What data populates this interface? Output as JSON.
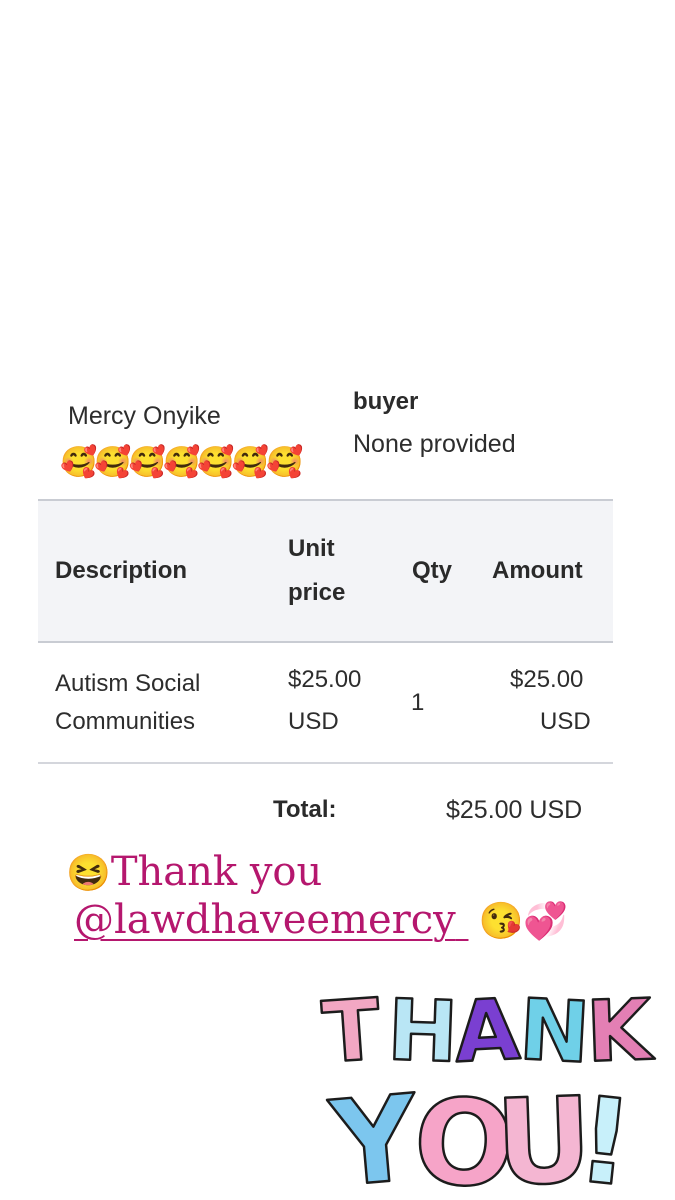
{
  "receipt": {
    "seller_name": "Mercy Onyike",
    "seller_emojis": "🥰🥰🥰🥰🥰🥰🥰",
    "buyer_label": "buyer",
    "buyer_value": "None provided",
    "table": {
      "headers": {
        "description": "Description",
        "unit_price_line1": "Unit",
        "unit_price_line2": "price",
        "qty": "Qty",
        "amount": "Amount"
      },
      "rows": [
        {
          "description_line1": "Autism Social",
          "description_line2": "Communities",
          "unit_price_line1": "$25.00",
          "unit_price_line2": "USD",
          "qty": "1",
          "amount_line1": "$25.00",
          "amount_line2": "USD"
        }
      ]
    },
    "total_label": "Total:",
    "total_value": "$25.00 USD"
  },
  "caption": {
    "leading_emoji": "😆",
    "thanks_text": "Thank you",
    "handle": "@lawdhaveemercy",
    "trailing_emojis": "😘💞"
  },
  "sticker": {
    "line1": "THANK",
    "line2": "YOU!",
    "colors": {
      "T": "#f2a7c3",
      "H": "#b9e6f5",
      "A": "#7a3fd1",
      "N": "#6fd0e8",
      "K": "#e37fb4",
      "Y": "#7cc6ee",
      "O": "#f6a4c8",
      "U": "#f4b6d2",
      "!": "#c8f0fa"
    }
  }
}
